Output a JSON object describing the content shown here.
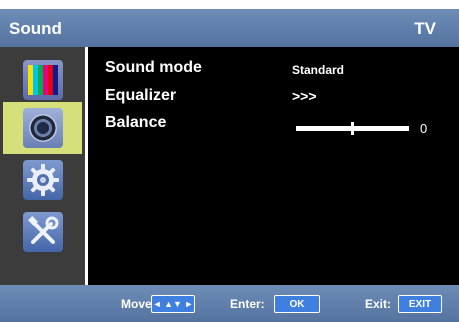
{
  "header": {
    "title": "Sound",
    "source": "TV"
  },
  "sidebar": {
    "items": [
      {
        "name": "Picture"
      },
      {
        "name": "Sound",
        "selected": true
      },
      {
        "name": "Setup"
      },
      {
        "name": "Tools"
      }
    ],
    "picture_colors": [
      "#f4e400",
      "#00c3f0",
      "#00b04e",
      "#e6007e",
      "#e60012",
      "#101a8c"
    ]
  },
  "rows": {
    "sound_mode": {
      "label": "Sound mode",
      "value": "Standard"
    },
    "equalizer": {
      "label": "Equalizer",
      "value": ">>>"
    },
    "balance": {
      "label": "Balance",
      "value": "0",
      "level_fraction": 0.5
    }
  },
  "footer": {
    "move_label": "Move:",
    "move_key": "◄ ▲▼ ►",
    "enter_label": "Enter:",
    "enter_key": "OK",
    "exit_label": "Exit:",
    "exit_key": "EXIT"
  },
  "colors": {
    "bar_blue": "#5f7fab",
    "selected_highlight": "#d6e07a",
    "key_blue": "#3f7fe0"
  }
}
